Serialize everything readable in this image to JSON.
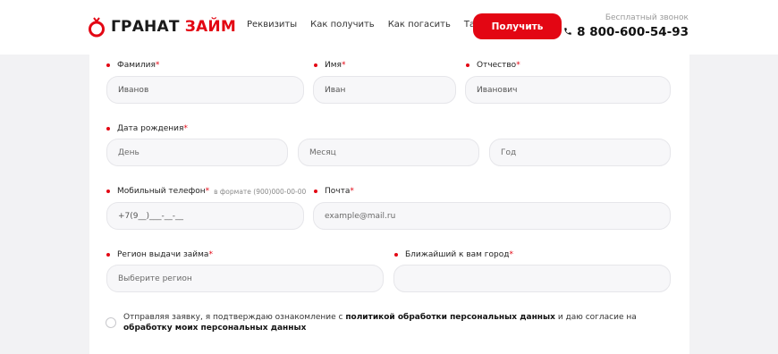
{
  "brand": {
    "word1": "ГРАНАТ",
    "word2": "ЗАЙМ",
    "accent_color": "#e30613",
    "logo_icon": "pomegranate-icon"
  },
  "nav": {
    "items": [
      "Реквизиты",
      "Как получить",
      "Как погасить",
      "Тарифы"
    ]
  },
  "cta": {
    "label": "Получить"
  },
  "contact": {
    "note": "Бесплатный звонок",
    "phone": "8 800-600-54-93",
    "icon": "phone-icon"
  },
  "form": {
    "required_mark": "*",
    "surname": {
      "label": "Фамилия",
      "value": "Иванов"
    },
    "name": {
      "label": "Имя",
      "value": "Иван"
    },
    "patronymic": {
      "label": "Отчество",
      "value": "Иванович"
    },
    "birthdate": {
      "label": "Дата рождения",
      "day": "День",
      "month": "Месяц",
      "year": "Год"
    },
    "mobile": {
      "label": "Мобильный телефон",
      "hint": "в формате (900)000-00-00",
      "value": "+7(9__)___-__-__"
    },
    "email": {
      "label": "Почта",
      "placeholder": "example@mail.ru"
    },
    "region": {
      "label": "Регион выдачи займа",
      "placeholder": "Выберите регион"
    },
    "city": {
      "label": "Ближайший к вам город",
      "placeholder": ""
    },
    "consent": {
      "part1": "Отправляя заявку, я подтверждаю ознакомление с ",
      "link1": "политикой обработки персональных данных",
      "part2": " и даю согласие на ",
      "link2": "обработку моих персональных данных"
    }
  }
}
